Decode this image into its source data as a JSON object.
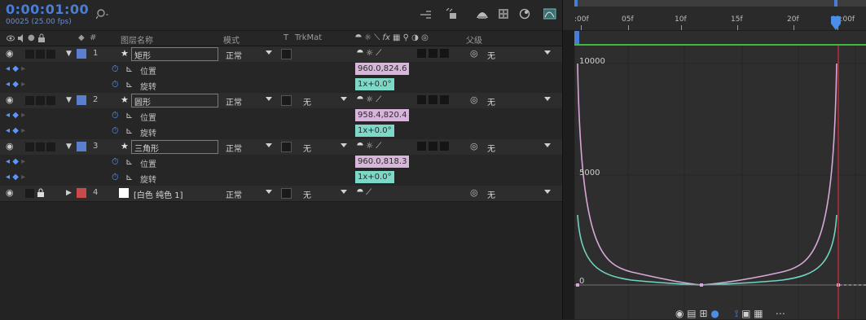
{
  "header": {
    "timecode": "0:00:01:00",
    "frame_info": "00025 (25.00 fps)",
    "search_placeholder": ""
  },
  "columns": {
    "layer_name": "图层名称",
    "mode": "模式",
    "t": "T",
    "trkmat": "TrkMat",
    "parent": "父级"
  },
  "layers": [
    {
      "index": "1",
      "name": "矩形",
      "mode": "正常",
      "trkmat": "",
      "parent": "无",
      "label_color": "#5b7fcf",
      "props": [
        {
          "name": "位置",
          "value": "960.0,824.6",
          "color": "pink"
        },
        {
          "name": "旋转",
          "value": "1x+0.0°",
          "color": "teal"
        }
      ]
    },
    {
      "index": "2",
      "name": "圆形",
      "mode": "正常",
      "trkmat": "无",
      "parent": "无",
      "label_color": "#5b7fcf",
      "props": [
        {
          "name": "位置",
          "value": "958.4,820.4",
          "color": "pink"
        },
        {
          "name": "旋转",
          "value": "1x+0.0°",
          "color": "teal"
        }
      ]
    },
    {
      "index": "3",
      "name": "三角形",
      "mode": "正常",
      "trkmat": "无",
      "parent": "无",
      "label_color": "#5b7fcf",
      "props": [
        {
          "name": "位置",
          "value": "960.0,818.3",
          "color": "pink"
        },
        {
          "name": "旋转",
          "value": "1x+0.0°",
          "color": "teal"
        }
      ]
    },
    {
      "index": "4",
      "name": "[白色 纯色 1]",
      "mode": "正常",
      "trkmat": "无",
      "parent": "无",
      "label_color": "#c94a4a"
    }
  ],
  "timeline": {
    "ticks": [
      ":00f",
      "05f",
      "10f",
      "15f",
      "20f",
      "01:00f"
    ]
  },
  "graph": {
    "labels": {
      "top": "10000",
      "mid": "5000",
      "bottom": "0"
    }
  },
  "colors": {
    "timecode": "#4a7dd6",
    "pink_value": "#d8b6dc",
    "teal_value": "#7dd8c8",
    "playhead": "#d9303c",
    "curve_pink": "#d9a6d8",
    "curve_teal": "#6fd4c1",
    "work_area": "#3dbb3d"
  }
}
